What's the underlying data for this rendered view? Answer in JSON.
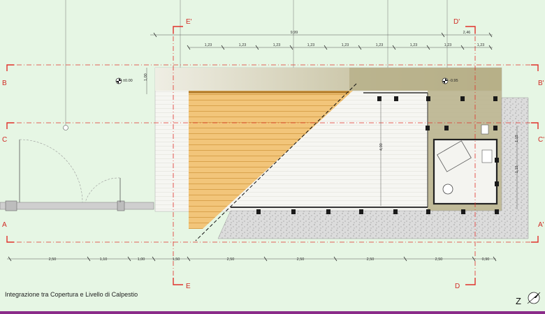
{
  "caption": "Integrazione tra Copertura e Livello di Calpestio",
  "section_marks": {
    "E_prime": "E'",
    "D_prime": "D'",
    "E": "E",
    "D": "D",
    "B_left": "B",
    "B_right": "B'",
    "C_left": "C",
    "C_right": "C'",
    "A_left": "A",
    "A_right": "A'"
  },
  "dimensions_top": {
    "overall": "9,99",
    "overall_right": "2,46",
    "modules": [
      "1,23",
      "1,23",
      "1,23",
      "1,23",
      "1,23",
      "1,23",
      "1,23",
      "1,23",
      "1,23"
    ]
  },
  "dimensions_bottom": [
    "2,50",
    "1,10",
    "1,00",
    "1,50",
    "2,50",
    "2,50",
    "2,50",
    "2,50",
    "0,90"
  ],
  "dimensions_vertical": {
    "left": "1,00",
    "center": "4,00",
    "right_top": "1,15",
    "right_bottom": "1,15"
  },
  "levels": {
    "left": "±0.00",
    "right": "-0.95"
  },
  "north_label": "Z",
  "colors": {
    "background": "#e6f6e4",
    "section_line": "#e0302a",
    "wood_deck": "#f0c070",
    "wood_deck_dark": "#c8902e",
    "green_roof": "#b4ad83",
    "gravel": "#d8d8d8",
    "accent_bar": "#8b2c8a"
  }
}
